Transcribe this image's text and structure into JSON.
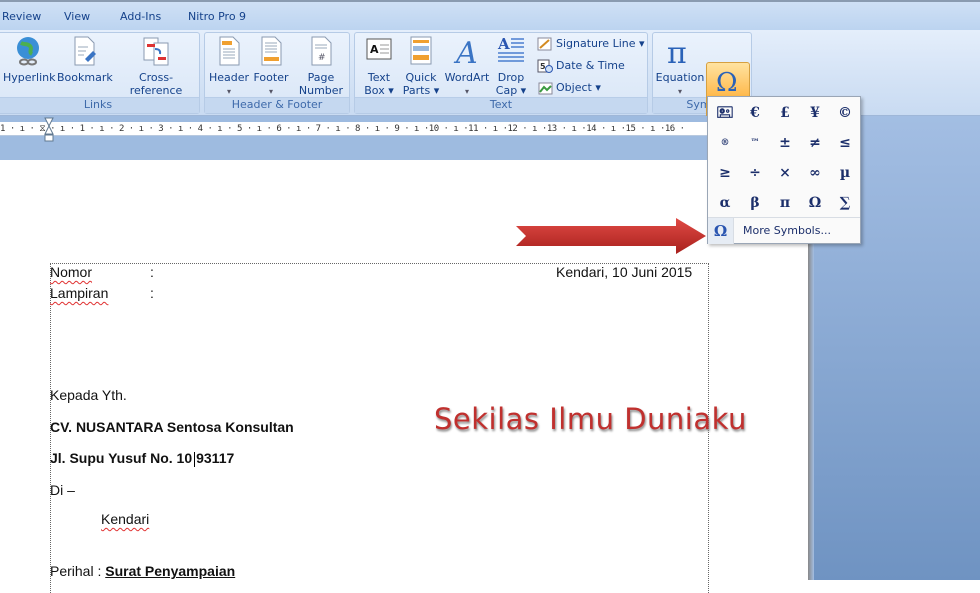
{
  "tabs": [
    "Review",
    "View",
    "Add-Ins",
    "Nitro Pro 9"
  ],
  "groups": {
    "links": {
      "label": "Links",
      "buttons": [
        "Hyperlink",
        "Bookmark",
        "Cross-reference"
      ]
    },
    "header_footer": {
      "label": "Header & Footer",
      "buttons": [
        {
          "l1": "Header",
          "l2": "▾"
        },
        {
          "l1": "Footer",
          "l2": "▾"
        },
        {
          "l1": "Page",
          "l2": "Number ▾"
        }
      ]
    },
    "text": {
      "label": "Text",
      "buttons": [
        {
          "l1": "Text",
          "l2": "Box ▾"
        },
        {
          "l1": "Quick",
          "l2": "Parts ▾"
        },
        {
          "l1": "WordArt",
          "l2": "▾"
        },
        {
          "l1": "Drop",
          "l2": "Cap ▾"
        }
      ],
      "small": [
        "Signature Line ▾",
        "Date & Time",
        "Object ▾"
      ]
    },
    "symbols": {
      "label": "Symb",
      "equation": "Equation",
      "symbol": "Symbol"
    }
  },
  "ruler": "1 · ı · ⧖ · ı · 1 · ı · 2 · ı · 3 · ı · 4 · ı · 5 · ı · 6 · ı · 7 · ı · 8 · ı · 9 · ı ·10 · ı ·11 · ı ·12 · ı ·13 · ı ·14 · ı ·15 · ı ·16 ·",
  "symbol_menu": {
    "symbols": [
      "🖭",
      "€",
      "£",
      "¥",
      "©",
      "®",
      "™",
      "±",
      "≠",
      "≤",
      "≥",
      "÷",
      "×",
      "∞",
      "µ",
      "α",
      "β",
      "π",
      "Ω",
      "∑"
    ],
    "more_icon": "Ω",
    "more_label": "More Symbols..."
  },
  "document": {
    "nomor": "Nomor",
    "lampiran": "Lampiran",
    "colon": ":",
    "date": "Kendari, 10 Juni 2015",
    "kepada": "Kepada Yth.",
    "company": "CV. NUSANTARA Sentosa Konsultan",
    "address_a": "Jl. Supu Yusuf No. 10",
    "address_b": "93117",
    "di": "Di –",
    "city": "Kendari",
    "perihal_label": "Perihal :",
    "perihal_value": "Surat Penyampaian"
  },
  "watermark": "Sekilas Ilmu Duniaku"
}
